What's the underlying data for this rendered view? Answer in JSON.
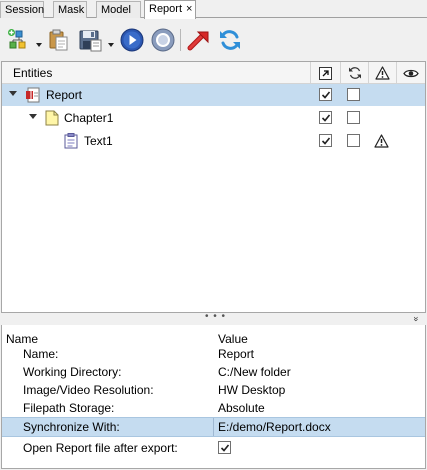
{
  "tabs": [
    {
      "label": "Session"
    },
    {
      "label": "Mask"
    },
    {
      "label": "Model"
    },
    {
      "label": "Report",
      "close": "×"
    }
  ],
  "toolbar": {
    "icons": [
      "add-entity-icon",
      "paste-icon",
      "save-icon",
      "play-icon",
      "stop-icon",
      "export-arrow-icon",
      "refresh-icon"
    ]
  },
  "entities": {
    "header": "Entities",
    "columns": [
      "open-link-icon",
      "sync-icon",
      "warning-icon",
      "eye-icon"
    ],
    "rows": [
      {
        "label": "Report",
        "col1": true,
        "col2": false,
        "warning": false
      },
      {
        "label": "Chapter1",
        "col1": true,
        "col2": false,
        "warning": false
      },
      {
        "label": "Text1",
        "col1": true,
        "col2": false,
        "warning": true
      }
    ]
  },
  "splitter": {
    "grip": "• • •",
    "collapse": "»"
  },
  "properties": {
    "name_header": "Name",
    "value_header": "Value",
    "rows": [
      {
        "name": "Name:",
        "value": "Report"
      },
      {
        "name": "Working Directory:",
        "value": "C:/New folder"
      },
      {
        "name": "Image/Video Resolution:",
        "value": "HW Desktop"
      },
      {
        "name": "Filepath Storage:",
        "value": "Absolute"
      },
      {
        "name": "Synchronize With:",
        "value": "E:/demo/Report.docx"
      },
      {
        "name": "Open Report file after export:",
        "value": true
      }
    ]
  },
  "colors": {
    "selection": "#c5dcf0",
    "play_blue": "#2b56b0",
    "export_red": "#d62828",
    "refresh_blue": "#2f8fd8"
  }
}
